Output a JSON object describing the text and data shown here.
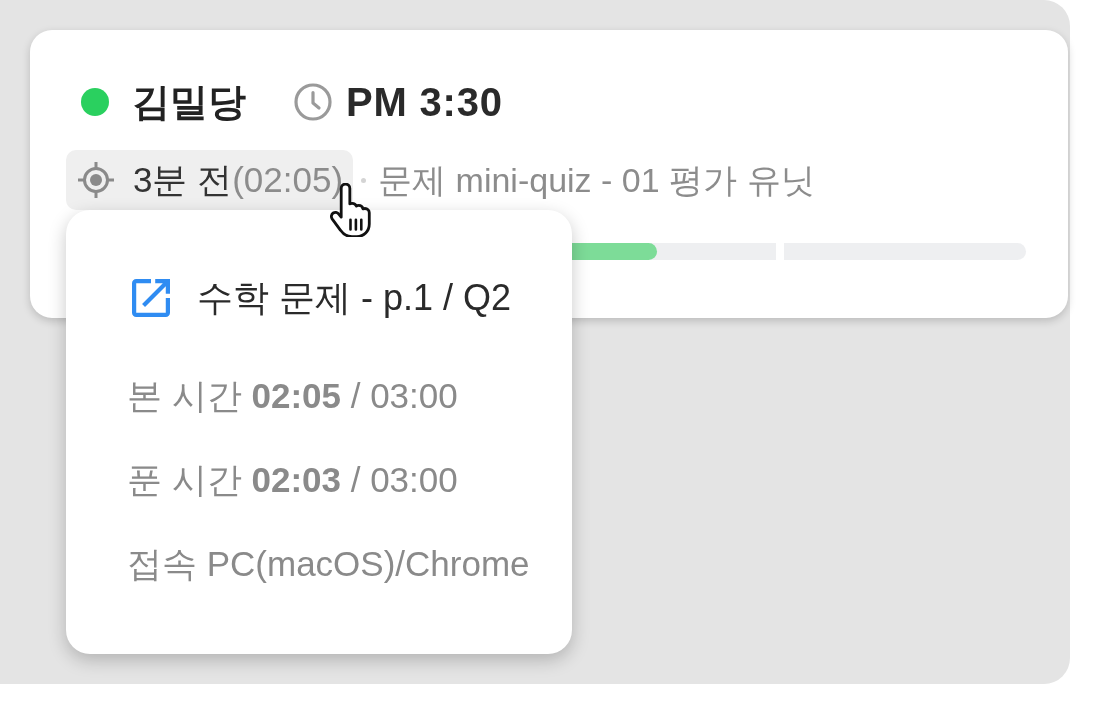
{
  "student": {
    "online": true,
    "name": "김밀당",
    "time": "PM 3:30"
  },
  "activity": {
    "chip": {
      "highlighted": true,
      "ago": "3분 전",
      "elapsed": "(02:05)"
    },
    "description": "문제 mini-quiz - 01 평가 유닛"
  },
  "progress": {
    "level": 0.61
  },
  "popover": {
    "title": "수학 문제 - p.1 / Q2",
    "rows": [
      "본 시간 **02:05** / 03:00",
      "푼 시간 **02:03** / 03:00",
      "접속 PC(macOS)/Chrome"
    ]
  }
}
